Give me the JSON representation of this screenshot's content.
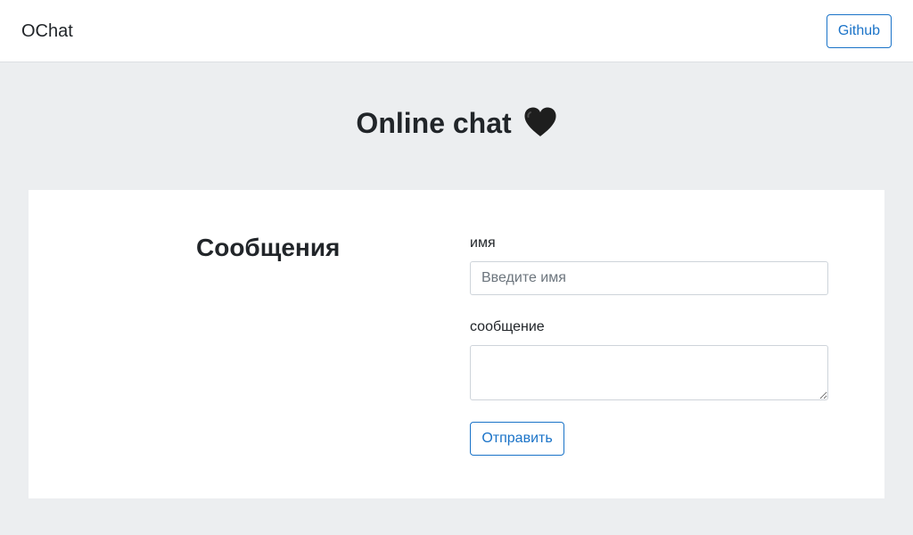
{
  "navbar": {
    "brand": "OChat",
    "github_label": "Github"
  },
  "hero": {
    "title": "Online chat",
    "icon": "black-heart-icon"
  },
  "messages": {
    "title": "Сообщения"
  },
  "form": {
    "name_label": "имя",
    "name_placeholder": "Введите имя",
    "name_value": "",
    "message_label": "сообщение",
    "message_value": "",
    "submit_label": "Отправить"
  },
  "colors": {
    "accent": "#1a73c8",
    "page_background": "#eceef0",
    "text": "#212529"
  }
}
